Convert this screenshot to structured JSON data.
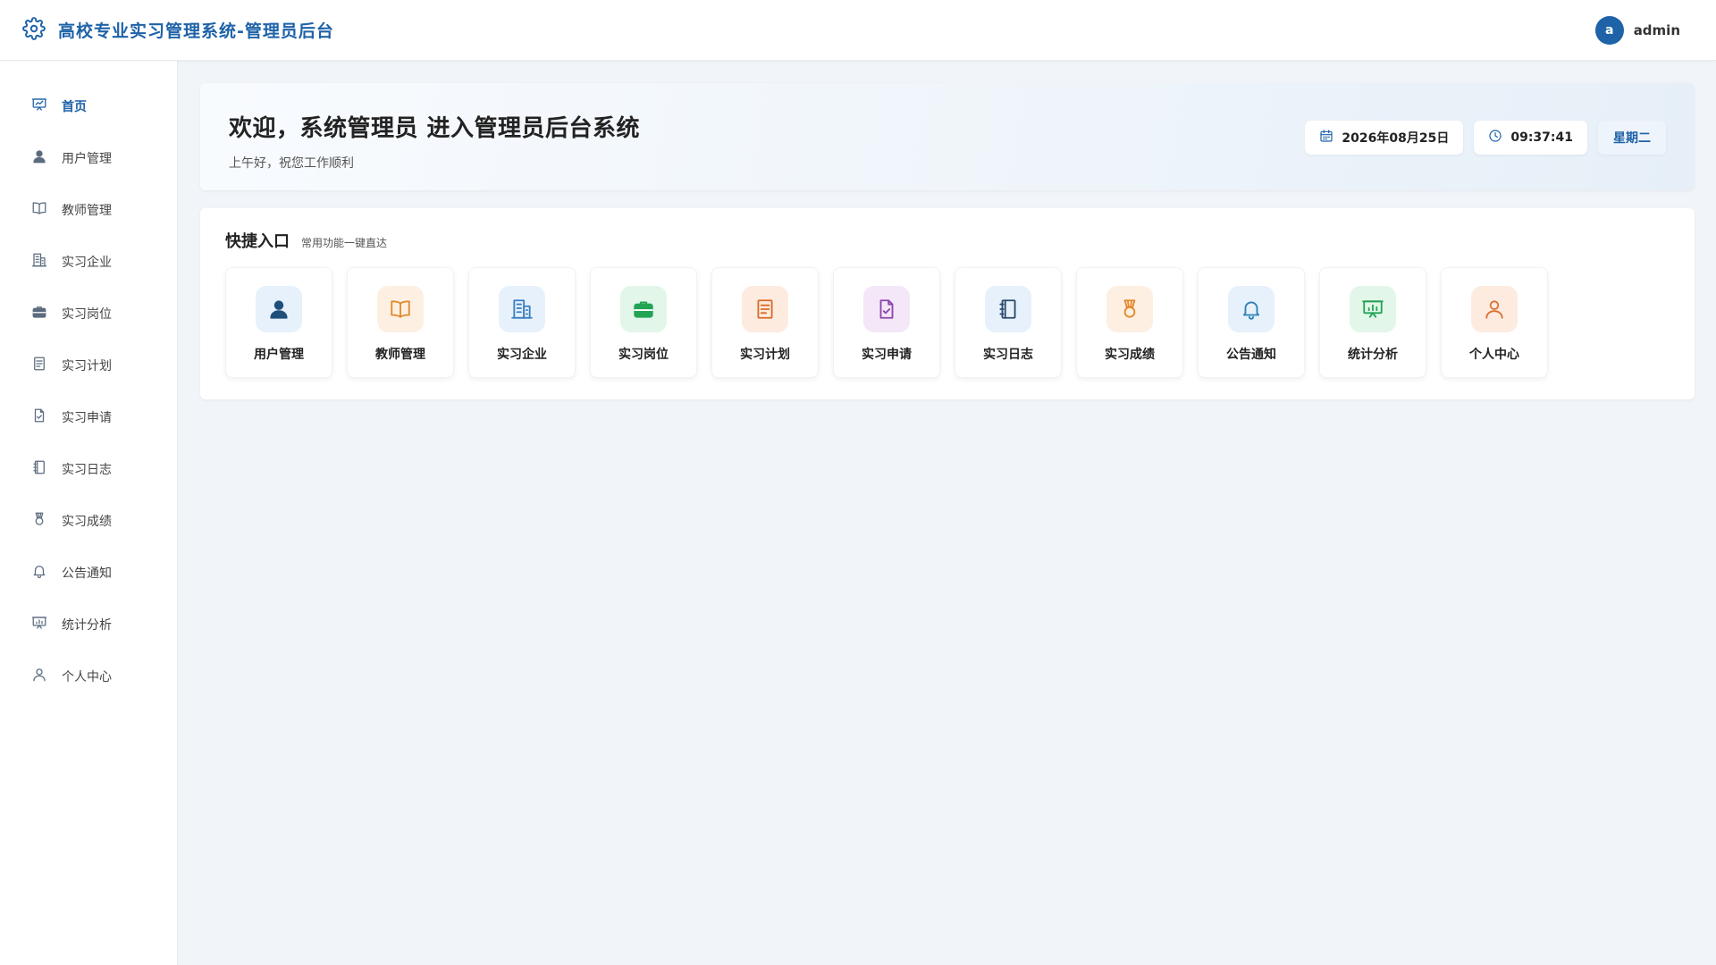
{
  "header": {
    "title": "高校专业实习管理系统-管理员后台",
    "avatar_letter": "a",
    "username": "admin"
  },
  "sidebar": {
    "items": [
      {
        "label": "首页",
        "icon": "presentation-chart-icon",
        "active": true
      },
      {
        "label": "用户管理",
        "icon": "user-icon"
      },
      {
        "label": "教师管理",
        "icon": "book-icon"
      },
      {
        "label": "实习企业",
        "icon": "building-icon"
      },
      {
        "label": "实习岗位",
        "icon": "briefcase-icon"
      },
      {
        "label": "实习计划",
        "icon": "document-icon"
      },
      {
        "label": "实习申请",
        "icon": "file-check-icon"
      },
      {
        "label": "实习日志",
        "icon": "notebook-icon"
      },
      {
        "label": "实习成绩",
        "icon": "medal-icon"
      },
      {
        "label": "公告通知",
        "icon": "bell-icon"
      },
      {
        "label": "统计分析",
        "icon": "chart-board-icon"
      },
      {
        "label": "个人中心",
        "icon": "person-icon"
      }
    ]
  },
  "welcome": {
    "title": "欢迎，系统管理员 进入管理员后台系统",
    "subtitle": "上午好，祝您工作顺利",
    "date": "2026年08月25日",
    "time": "09:37:41",
    "weekday": "星期二"
  },
  "quick": {
    "title": "快捷入口",
    "subtitle": "常用功能一键直达",
    "cards": [
      {
        "label": "用户管理",
        "icon": "user-icon",
        "color": "#1e4f7a",
        "bg": "#e6f1fb"
      },
      {
        "label": "教师管理",
        "icon": "book-icon",
        "color": "#e08a2c",
        "bg": "#fdf0e2"
      },
      {
        "label": "实习企业",
        "icon": "building-icon",
        "color": "#3a7fc1",
        "bg": "#e6f1fb"
      },
      {
        "label": "实习岗位",
        "icon": "briefcase-icon",
        "color": "#23a455",
        "bg": "#e3f6ea"
      },
      {
        "label": "实习计划",
        "icon": "document-icon",
        "color": "#dc6a25",
        "bg": "#fdebe0"
      },
      {
        "label": "实习申请",
        "icon": "file-check-icon",
        "color": "#8e44ad",
        "bg": "#f3e7f8"
      },
      {
        "label": "实习日志",
        "icon": "notebook-icon",
        "color": "#2c4a6e",
        "bg": "#e6f1fb"
      },
      {
        "label": "实习成绩",
        "icon": "medal-icon",
        "color": "#e6892c",
        "bg": "#fdf0e2"
      },
      {
        "label": "公告通知",
        "icon": "bell-icon",
        "color": "#2f80b5",
        "bg": "#e6f1fb"
      },
      {
        "label": "统计分析",
        "icon": "chart-board-icon",
        "color": "#23a455",
        "bg": "#e3f6ea"
      },
      {
        "label": "个人中心",
        "icon": "person-icon",
        "color": "#d9722f",
        "bg": "#fdebe0"
      }
    ]
  },
  "colors": {
    "primary": "#1e62a8",
    "sidebar_icon": "#5b6b7f"
  }
}
